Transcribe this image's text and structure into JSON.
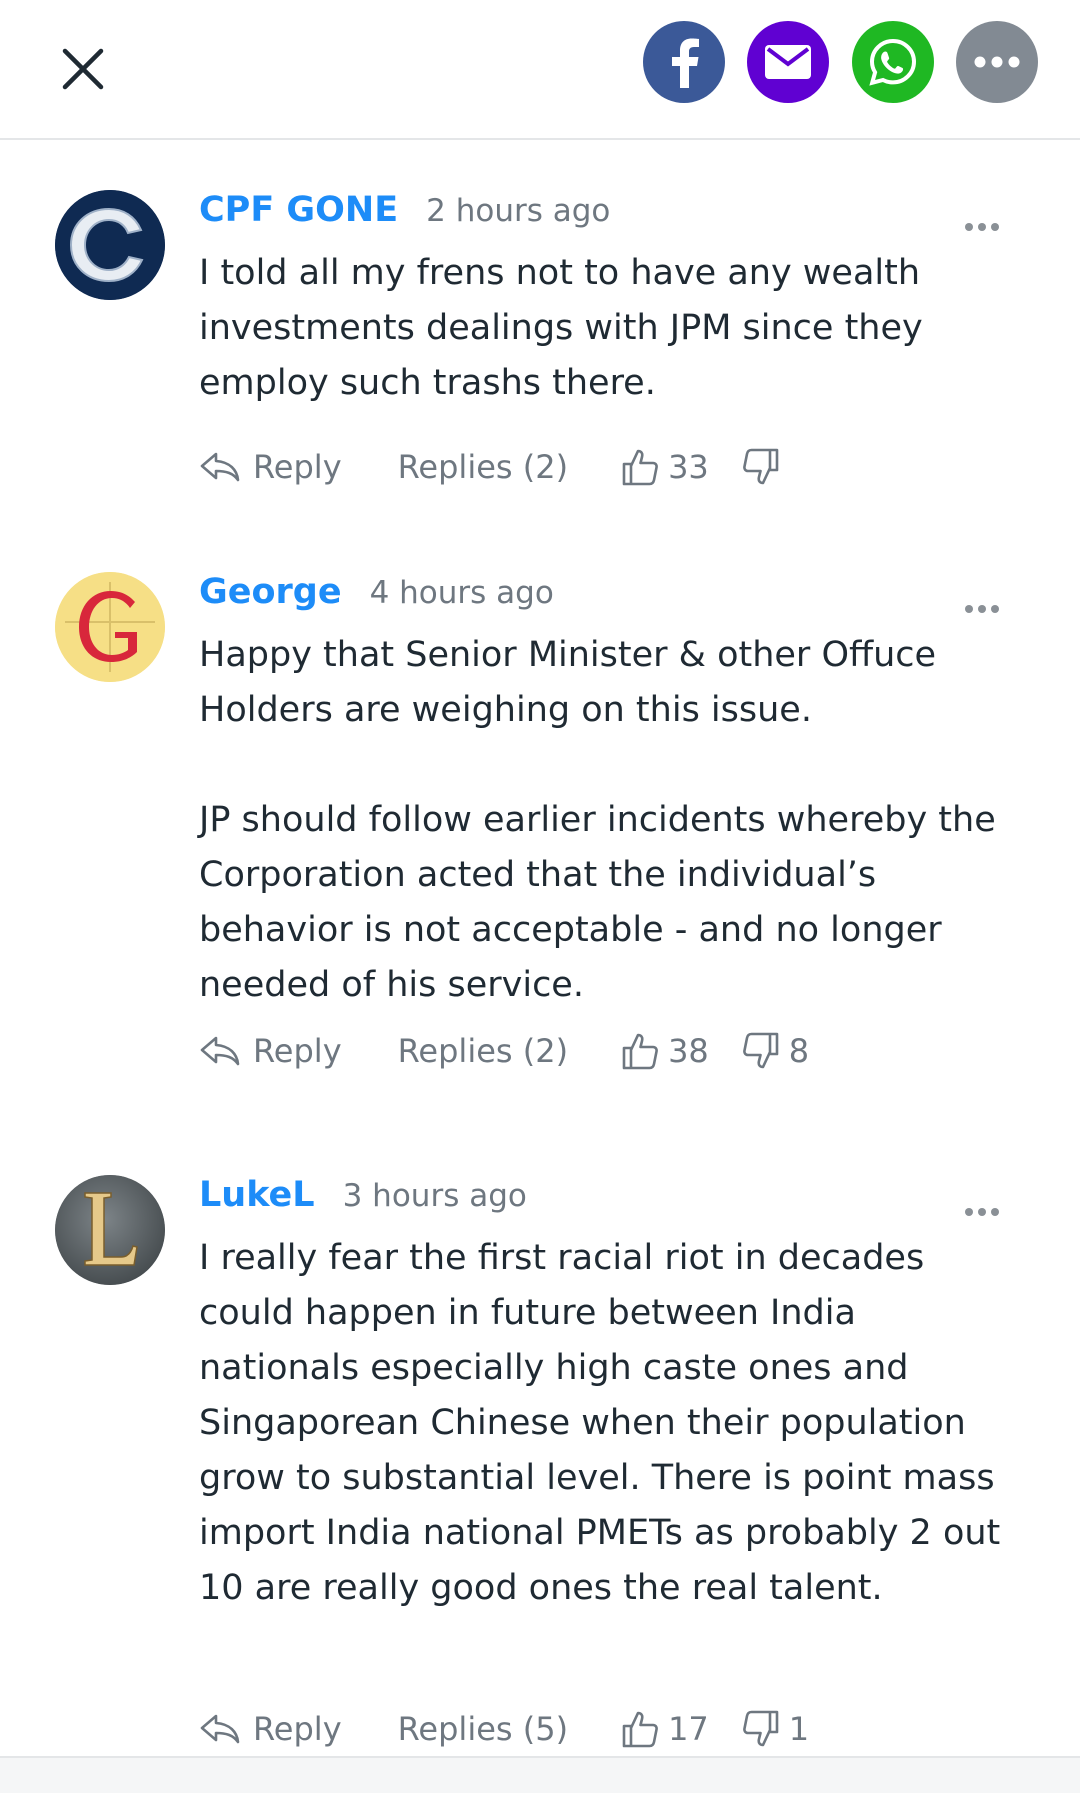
{
  "header": {
    "close_icon": "close-icon",
    "share": [
      {
        "name": "facebook",
        "icon": "facebook-icon",
        "color": "#3b5998"
      },
      {
        "name": "email",
        "icon": "mail-icon",
        "color": "#6001d2"
      },
      {
        "name": "whatsapp",
        "icon": "whatsapp-icon",
        "color": "#1fb823"
      },
      {
        "name": "more",
        "icon": "more-dots-icon",
        "color": "#828a93"
      }
    ]
  },
  "colors": {
    "username": "#1d8cf8",
    "muted": "#6e7780",
    "divider": "#e4e6e8"
  },
  "comments": [
    {
      "avatar_letter": "C",
      "username": "CPF GONE",
      "time": "2 hours ago",
      "text": "I told all my frens not to have any wealth investments dealings with JPM since they employ such trashs there.",
      "reply_label": "Reply",
      "replies_label": "Replies (2)",
      "thumbs_up": "33",
      "thumbs_down": ""
    },
    {
      "avatar_letter": "G",
      "username": "George",
      "time": "4 hours ago",
      "text": "Happy that Senior Minister & other Offuce Holders are weighing on this issue.\n\nJP should follow earlier incidents whereby the Corporation acted that the individual’s behavior is not acceptable - and no longer needed of his service.",
      "reply_label": "Reply",
      "replies_label": "Replies (2)",
      "thumbs_up": "38",
      "thumbs_down": "8"
    },
    {
      "avatar_letter": "L",
      "username": "LukeL",
      "time": "3 hours ago",
      "text": "I really fear the first racial riot in decades could happen in future between India nationals especially high caste ones and Singaporean Chinese when their population grow to substantial level. There is point mass import India national PMETs as probably 2 out 10 are really good ones the real talent.",
      "reply_label": "Reply",
      "replies_label": "Replies (5)",
      "thumbs_up": "17",
      "thumbs_down": "1"
    }
  ]
}
